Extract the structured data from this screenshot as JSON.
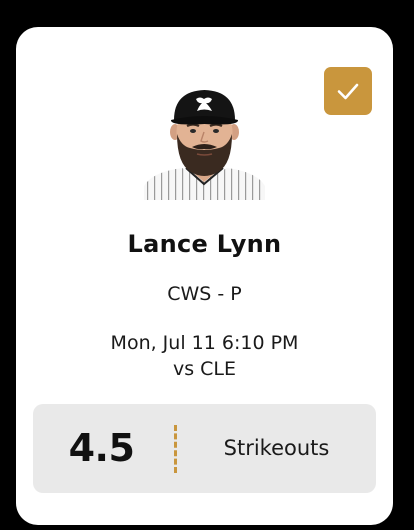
{
  "colors": {
    "accent": "#c9963d",
    "card_bg": "#ffffff",
    "prop_bg": "#e9e9e9",
    "page_bg": "#000000"
  },
  "selection": {
    "icon": "checkmark-icon",
    "selected": true
  },
  "player": {
    "name": "Lance Lynn",
    "team_position": "CWS - P",
    "game_time": "Mon, Jul 11 6:10 PM",
    "opponent": "vs CLE",
    "headshot_icon": "player-headshot"
  },
  "prop": {
    "line": "4.5",
    "stat": "Strikeouts"
  }
}
